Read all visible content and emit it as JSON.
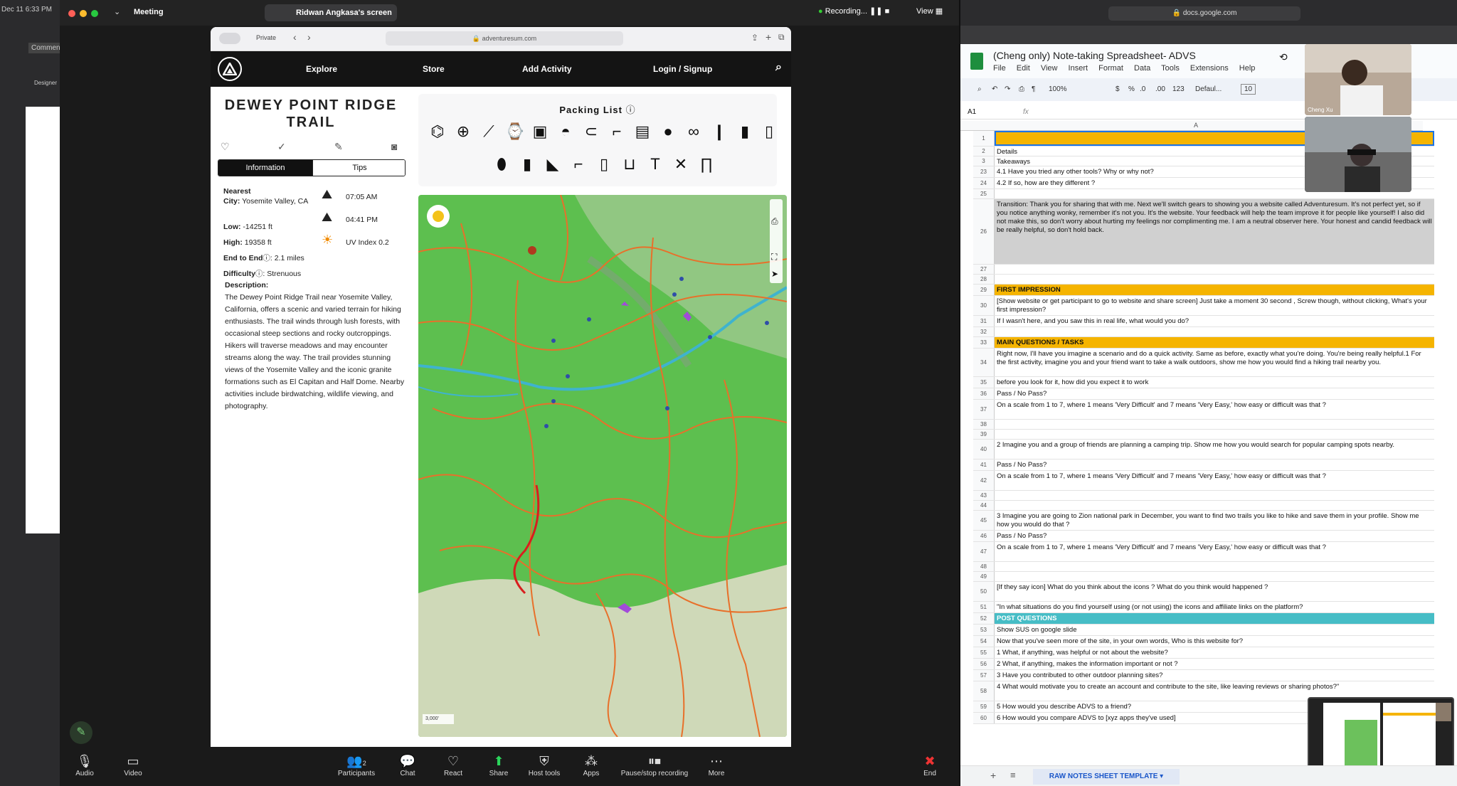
{
  "os": {
    "clock": "Dec 11 6:33 PM"
  },
  "zoom": {
    "app_label": "Meeting",
    "share_label": "Ridwan Angkasa's screen",
    "recording_label": "Recording...",
    "view_label": "View",
    "toolbar": {
      "audio": "Audio",
      "video": "Video",
      "participants": "Participants",
      "participants_count": "2",
      "chat": "Chat",
      "react": "React",
      "share": "Share",
      "host_tools": "Host tools",
      "apps": "Apps",
      "pause_stop": "Pause/stop recording",
      "more": "More",
      "end": "End"
    }
  },
  "safari": {
    "private_label": "Private",
    "url": "adventuresum.com"
  },
  "site": {
    "nav": {
      "explore": "Explore",
      "store": "Store",
      "add_activity": "Add Activity",
      "login": "Login / Signup"
    },
    "trail_title": "DEWEY POINT RIDGE TRAIL",
    "tabs": {
      "information": "Information",
      "tips": "Tips"
    },
    "info": {
      "nearest_label": "Nearest",
      "city_label": "City:",
      "city_value": "Yosemite Valley, CA",
      "low_label": "Low:",
      "low_value": "-14251 ft",
      "high_label": "High:",
      "high_value": "19358 ft",
      "end_label": "End to End",
      "end_value": "2.1 miles",
      "difficulty_label": "Difficulty",
      "difficulty_value": "Strenuous",
      "sunrise": "07:05 AM",
      "sunset": "04:41 PM",
      "uv": "UV Index 0.2"
    },
    "description_label": "Description:",
    "description": "The Dewey Point Ridge Trail near Yosemite Valley, California, offers a scenic and varied terrain for hiking enthusiasts. The trail winds through lush forests, with occasional steep sections and rocky outcroppings. Hikers will traverse meadows and may encounter streams along the way. The trail provides stunning views of the Yosemite Valley and the iconic granite formations such as El Capitan and Half Dome. Nearby activities include birdwatching, wildlife viewing, and photography.",
    "packing_title": "Packing List",
    "map_scale": "3,000'"
  },
  "chrome": {
    "url": "docs.google.com"
  },
  "sheets": {
    "title": "(Cheng only) Note-taking Spreadsheet- ADVS",
    "menu": [
      "File",
      "Edit",
      "View",
      "Insert",
      "Format",
      "Data",
      "Tools",
      "Extensions",
      "Help"
    ],
    "toolbar": {
      "zoom": "100%",
      "currency": "$",
      "percent": "%",
      "decdown": ".0",
      "decup": ".00",
      "num": "123",
      "font": "Defaul...",
      "size": "10"
    },
    "cell_ref": "A1",
    "fx": "fx",
    "col_a": "A",
    "rows": [
      {
        "n": "1",
        "t": "",
        "h": 22,
        "bg": "#f5b400"
      },
      {
        "n": "2",
        "t": "Details",
        "h": 14,
        "bg": ""
      },
      {
        "n": "3",
        "t": "Takeaways",
        "h": 14,
        "bg": ""
      },
      {
        "n": "23",
        "t": "4.1 Have you tried any other tools? Why or why not?",
        "h": 16,
        "bg": ""
      },
      {
        "n": "24",
        "t": "4.2 If so, how are they different ?",
        "h": 16,
        "bg": ""
      },
      {
        "n": "25",
        "t": "",
        "h": 14,
        "bg": ""
      },
      {
        "n": "26",
        "t": "Transition: Thank you for sharing that with me. Next we'll switch gears to showing you a website called Adventuresum. It's not perfect yet, so if you notice anything wonky, remember it's not you. It's the website. Your feedback will help the team improve it for people like yourself! I also did not make this, so don't worry about hurting my feelings nor complimenting me. I am a neutral observer here. Your honest and candid feedback will be really helpful, so don't hold back.",
        "h": 92,
        "bg": "#d0d0d0"
      },
      {
        "n": "27",
        "t": "",
        "h": 14,
        "bg": ""
      },
      {
        "n": "28",
        "t": "",
        "h": 14,
        "bg": ""
      },
      {
        "n": "29",
        "t": "FIRST IMPRESSION",
        "h": 16,
        "bg": "#f5b400"
      },
      {
        "n": "30",
        "t": "[Show website or get participant to go to website and share screen] Just take a moment 30 second , Screw though, without clicking, What's your first impression?",
        "h": 28,
        "bg": ""
      },
      {
        "n": "31",
        "t": "If I wasn't here, and you saw this in real life, what would you do?",
        "h": 16,
        "bg": ""
      },
      {
        "n": "32",
        "t": "",
        "h": 14,
        "bg": ""
      },
      {
        "n": "33",
        "t": "MAIN QUESTIONS / TASKS",
        "h": 16,
        "bg": "#f5b400"
      },
      {
        "n": "34",
        "t": "Right now, I'll have you imagine a scenario and do a quick activity. Same as before, exactly what you're doing. You're being really helpful.1 For the first activity, imagine you and your friend want to take a walk outdoors, show me how you would find a hiking trail nearby you.",
        "h": 40,
        "bg": ""
      },
      {
        "n": "35",
        "t": "before you look for it, how did you expect it to work",
        "h": 16,
        "bg": ""
      },
      {
        "n": "36",
        "t": "Pass / No Pass?",
        "h": 16,
        "bg": ""
      },
      {
        "n": "37",
        "t": "On a scale from 1 to 7, where 1 means 'Very Difficult' and 7 means 'Very Easy,' how easy or difficult was that ?",
        "h": 28,
        "bg": ""
      },
      {
        "n": "38",
        "t": "",
        "h": 14,
        "bg": ""
      },
      {
        "n": "39",
        "t": "",
        "h": 14,
        "bg": ""
      },
      {
        "n": "40",
        "t": "2 Imagine you and a group of friends are planning a camping trip. Show me how you would search for popular camping spots nearby.",
        "h": 28,
        "bg": ""
      },
      {
        "n": "41",
        "t": "Pass / No Pass?",
        "h": 16,
        "bg": ""
      },
      {
        "n": "42",
        "t": "On a scale from 1 to 7, where 1 means 'Very Difficult' and 7 means 'Very Easy,' how easy or difficult was that ?",
        "h": 28,
        "bg": ""
      },
      {
        "n": "43",
        "t": "",
        "h": 14,
        "bg": ""
      },
      {
        "n": "44",
        "t": "",
        "h": 14,
        "bg": ""
      },
      {
        "n": "45",
        "t": "3 Imagine you are going to Zion national park in December, you want to find two trails you like to hike and save them in your profile. Show me how you would do that ?",
        "h": 28,
        "bg": ""
      },
      {
        "n": "46",
        "t": "Pass / No Pass?",
        "h": 16,
        "bg": ""
      },
      {
        "n": "47",
        "t": "On a scale from 1 to 7, where 1 means 'Very Difficult' and 7 means 'Very Easy,' how easy or difficult was that ?",
        "h": 28,
        "bg": ""
      },
      {
        "n": "48",
        "t": "",
        "h": 14,
        "bg": ""
      },
      {
        "n": "49",
        "t": "",
        "h": 14,
        "bg": ""
      },
      {
        "n": "50",
        "t": "[If they say icon] What do you think about the icons ? What do you think would happened ?",
        "h": 28,
        "bg": ""
      },
      {
        "n": "51",
        "t": "\"In what situations do you find yourself using (or not using) the icons and affiliate links on the platform?",
        "h": 16,
        "bg": ""
      },
      {
        "n": "52",
        "t": "POST QUESTIONS",
        "h": 16,
        "bg": "#46bdc6"
      },
      {
        "n": "53",
        "t": "Show SUS on google slide",
        "h": 16,
        "bg": ""
      },
      {
        "n": "54",
        "t": "Now that you've seen more of the site, in your own words, Who is this website for?",
        "h": 16,
        "bg": ""
      },
      {
        "n": "55",
        "t": "1 What, if anything, was helpful or not about the website?",
        "h": 16,
        "bg": ""
      },
      {
        "n": "56",
        "t": "2 What, if anything, makes the information important or not ?",
        "h": 16,
        "bg": ""
      },
      {
        "n": "57",
        "t": "3 Have you contributed to other outdoor planning sites?",
        "h": 16,
        "bg": ""
      },
      {
        "n": "58",
        "t": "4 What would motivate you to create an account and contribute to the site, like leaving reviews or sharing photos?\"",
        "h": 28,
        "bg": ""
      },
      {
        "n": "59",
        "t": "5 How would you describe ADVS to a friend?",
        "h": 16,
        "bg": ""
      },
      {
        "n": "60",
        "t": "6 How would you compare ADVS to [xyz apps they've used]",
        "h": 16,
        "bg": ""
      }
    ],
    "sheet_tab": "RAW NOTES SHEET TEMPLATE",
    "participant_name": "Cheng Xu"
  },
  "left_strip": {
    "comment": "Commen",
    "designer": "Designer"
  }
}
